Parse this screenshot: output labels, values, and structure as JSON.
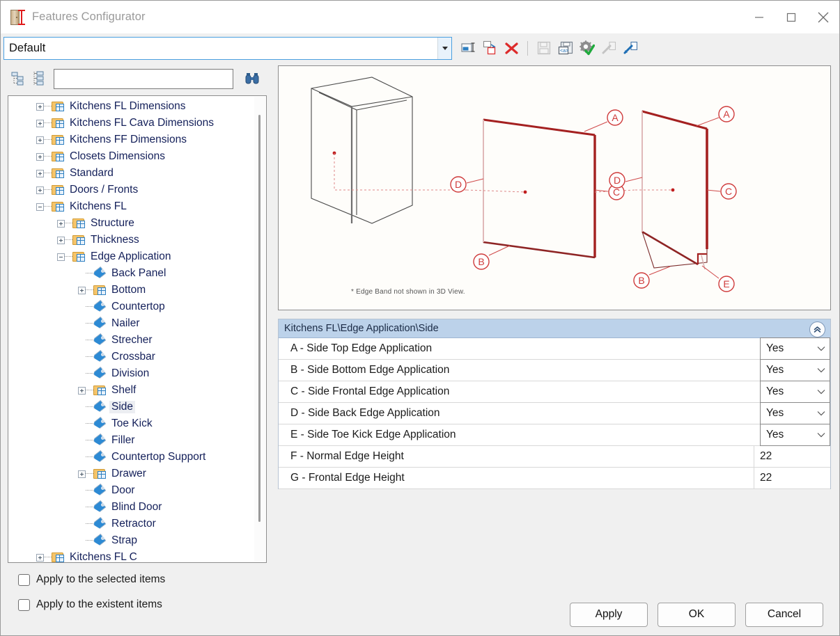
{
  "window": {
    "title": "Features Configurator",
    "icon": "cabinet-ruler-icon",
    "minimize": "–",
    "maximize": "□",
    "close": "×"
  },
  "profile": {
    "value": "Default",
    "dropdown_icon": "chevron-down-icon"
  },
  "toolbar": [
    {
      "name": "rename-profile-button",
      "icon": "rename-icon",
      "enabled": true
    },
    {
      "name": "duplicate-profile-button",
      "icon": "duplicate-icon",
      "enabled": true
    },
    {
      "name": "delete-profile-button",
      "icon": "delete-x-icon",
      "enabled": true
    },
    {
      "name": "save-button",
      "icon": "save-disk-icon",
      "enabled": false
    },
    {
      "name": "save-xml-button",
      "icon": "save-xml-icon",
      "enabled": true
    },
    {
      "name": "apply-settings-button",
      "icon": "gear-check-icon",
      "enabled": true
    },
    {
      "name": "export-button",
      "icon": "export-arrow-icon",
      "enabled": false
    },
    {
      "name": "import-button",
      "icon": "import-arrow-icon",
      "enabled": true
    }
  ],
  "tree_toolbar": {
    "collapse_all": "collapse-tree-icon",
    "expand_all": "expand-tree-icon",
    "find_icon": "binoculars-icon",
    "search_value": "",
    "search_placeholder": ""
  },
  "tree": {
    "items": [
      {
        "label": "Kitchens FL Dimensions",
        "indent": 0,
        "type": "folder",
        "state": "collapsed",
        "selected": false
      },
      {
        "label": "Kitchens FL Cava Dimensions",
        "indent": 0,
        "type": "folder",
        "state": "collapsed",
        "selected": false
      },
      {
        "label": "Kitchens FF Dimensions",
        "indent": 0,
        "type": "folder",
        "state": "collapsed",
        "selected": false
      },
      {
        "label": "Closets Dimensions",
        "indent": 0,
        "type": "folder",
        "state": "collapsed",
        "selected": false
      },
      {
        "label": "Standard",
        "indent": 0,
        "type": "folder",
        "state": "collapsed",
        "selected": false
      },
      {
        "label": "Doors / Fronts",
        "indent": 0,
        "type": "folder",
        "state": "collapsed",
        "selected": false
      },
      {
        "label": "Kitchens FL",
        "indent": 0,
        "type": "folder",
        "state": "expanded",
        "selected": false
      },
      {
        "label": "Structure",
        "indent": 1,
        "type": "folder",
        "state": "collapsed",
        "selected": false
      },
      {
        "label": "Thickness",
        "indent": 1,
        "type": "folder",
        "state": "collapsed",
        "selected": false
      },
      {
        "label": "Edge Application",
        "indent": 1,
        "type": "folder",
        "state": "expanded",
        "selected": false
      },
      {
        "label": "Back Panel",
        "indent": 2,
        "type": "leaf",
        "state": "none",
        "selected": false
      },
      {
        "label": "Bottom",
        "indent": 2,
        "type": "folder",
        "state": "collapsed",
        "selected": false
      },
      {
        "label": "Countertop",
        "indent": 2,
        "type": "leaf",
        "state": "none",
        "selected": false
      },
      {
        "label": "Nailer",
        "indent": 2,
        "type": "leaf",
        "state": "none",
        "selected": false
      },
      {
        "label": "Strecher",
        "indent": 2,
        "type": "leaf",
        "state": "none",
        "selected": false
      },
      {
        "label": "Crossbar",
        "indent": 2,
        "type": "leaf",
        "state": "none",
        "selected": false
      },
      {
        "label": "Division",
        "indent": 2,
        "type": "leaf",
        "state": "none",
        "selected": false
      },
      {
        "label": "Shelf",
        "indent": 2,
        "type": "folder",
        "state": "collapsed",
        "selected": false
      },
      {
        "label": "Side",
        "indent": 2,
        "type": "leaf",
        "state": "none",
        "selected": true
      },
      {
        "label": "Toe Kick",
        "indent": 2,
        "type": "leaf",
        "state": "none",
        "selected": false
      },
      {
        "label": "Filler",
        "indent": 2,
        "type": "leaf",
        "state": "none",
        "selected": false
      },
      {
        "label": "Countertop Support",
        "indent": 2,
        "type": "leaf",
        "state": "none",
        "selected": false
      },
      {
        "label": "Drawer",
        "indent": 2,
        "type": "folder",
        "state": "collapsed",
        "selected": false
      },
      {
        "label": "Door",
        "indent": 2,
        "type": "leaf",
        "state": "none",
        "selected": false
      },
      {
        "label": "Blind Door",
        "indent": 2,
        "type": "leaf",
        "state": "none",
        "selected": false
      },
      {
        "label": "Retractor",
        "indent": 2,
        "type": "leaf",
        "state": "none",
        "selected": false
      },
      {
        "label": "Strap",
        "indent": 2,
        "type": "leaf",
        "state": "none",
        "selected": false
      },
      {
        "label": "Kitchens FL C",
        "indent": 0,
        "type": "folder",
        "state": "collapsed",
        "selected": false
      }
    ]
  },
  "preview": {
    "note": "* Edge Band not shown in 3D View.",
    "callouts": [
      "A",
      "B",
      "C",
      "D",
      "E"
    ],
    "accent_color": "#b01c1c"
  },
  "properties": {
    "header": "Kitchens FL\\Edge Application\\Side",
    "collapse_icon": "chevron-double-up-icon",
    "rows": [
      {
        "label": "A - Side Top Edge Application",
        "value": "Yes",
        "control": "combo"
      },
      {
        "label": "B - Side Bottom Edge Application",
        "value": "Yes",
        "control": "combo"
      },
      {
        "label": "C - Side Frontal Edge Application",
        "value": "Yes",
        "control": "combo"
      },
      {
        "label": "D - Side Back Edge Application",
        "value": "Yes",
        "control": "combo"
      },
      {
        "label": "E - Side Toe Kick Edge Application",
        "value": "Yes",
        "control": "combo"
      },
      {
        "label": "F - Normal Edge Height",
        "value": "22",
        "control": "text"
      },
      {
        "label": "G - Frontal Edge Height",
        "value": "22",
        "control": "text"
      }
    ]
  },
  "options": {
    "apply_selected": {
      "label": "Apply to the selected items",
      "checked": false
    },
    "apply_existent": {
      "label": "Apply to the existent items",
      "checked": false
    }
  },
  "footer": {
    "apply": "Apply",
    "ok": "OK",
    "cancel": "Cancel"
  }
}
